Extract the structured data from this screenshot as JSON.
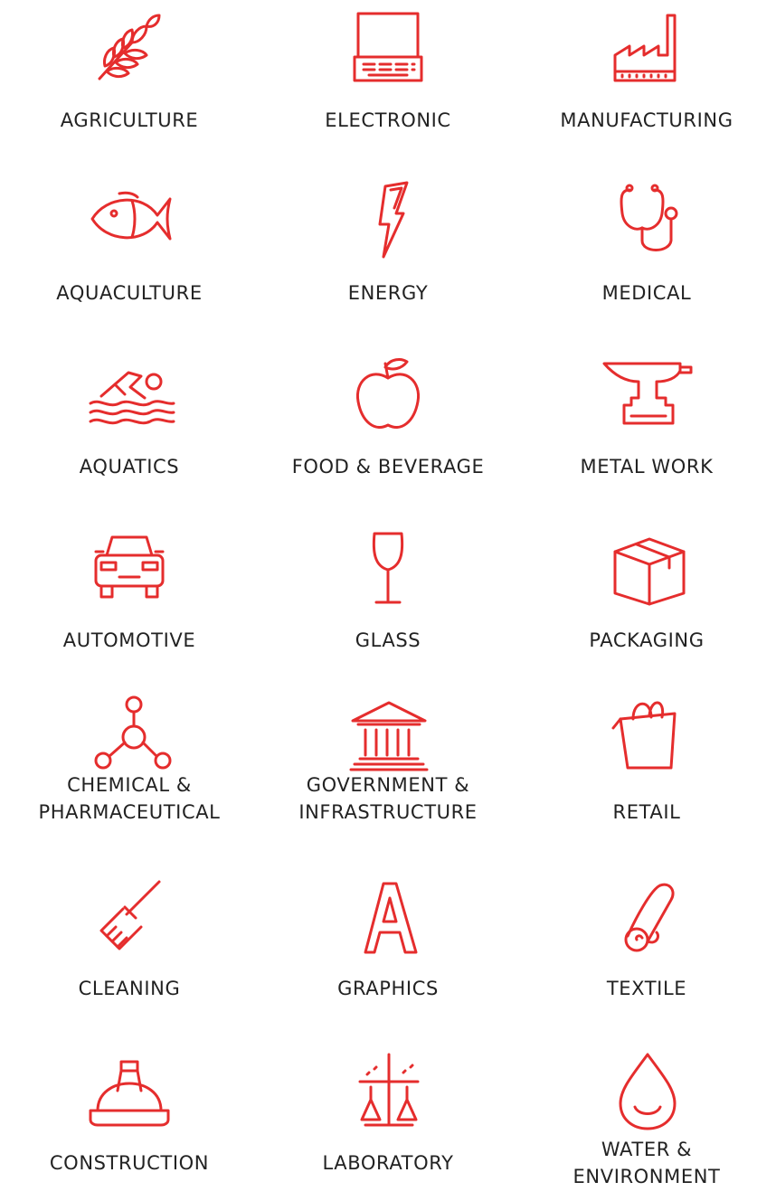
{
  "accent_color": "#e52d2d",
  "industries": [
    {
      "name": "AGRICULTURE",
      "icon": "wheat-icon"
    },
    {
      "name": "ELECTRONIC",
      "icon": "laptop-icon"
    },
    {
      "name": "MANUFACTURING",
      "icon": "factory-icon"
    },
    {
      "name": "AQUACULTURE",
      "icon": "fish-icon"
    },
    {
      "name": "ENERGY",
      "icon": "lightning-bolt-icon"
    },
    {
      "name": "MEDICAL",
      "icon": "stethoscope-icon"
    },
    {
      "name": "AQUATICS",
      "icon": "swimmer-icon"
    },
    {
      "name": "FOOD & BEVERAGE",
      "icon": "apple-icon"
    },
    {
      "name": "METAL WORK",
      "icon": "anvil-icon"
    },
    {
      "name": "AUTOMOTIVE",
      "icon": "car-icon"
    },
    {
      "name": "GLASS",
      "icon": "wine-glass-icon"
    },
    {
      "name": "PACKAGING",
      "icon": "box-icon"
    },
    {
      "name": "CHEMICAL &",
      "name_line2": "PHARMACEUTICAL",
      "icon": "molecule-icon"
    },
    {
      "name": "GOVERNMENT &",
      "name_line2": "INFRASTRUCTURE",
      "icon": "government-building-icon"
    },
    {
      "name": "RETAIL",
      "icon": "shopping-bag-icon"
    },
    {
      "name": "CLEANING",
      "icon": "brush-icon"
    },
    {
      "name": "GRAPHICS",
      "icon": "letter-a-icon"
    },
    {
      "name": "TEXTILE",
      "icon": "fabric-roll-icon"
    },
    {
      "name": "CONSTRUCTION",
      "icon": "hard-hat-icon"
    },
    {
      "name": "LABORATORY",
      "icon": "flasks-scale-icon"
    },
    {
      "name": "WATER &",
      "name_line2": "ENVIRONMENT",
      "icon": "water-drop-icon"
    }
  ]
}
